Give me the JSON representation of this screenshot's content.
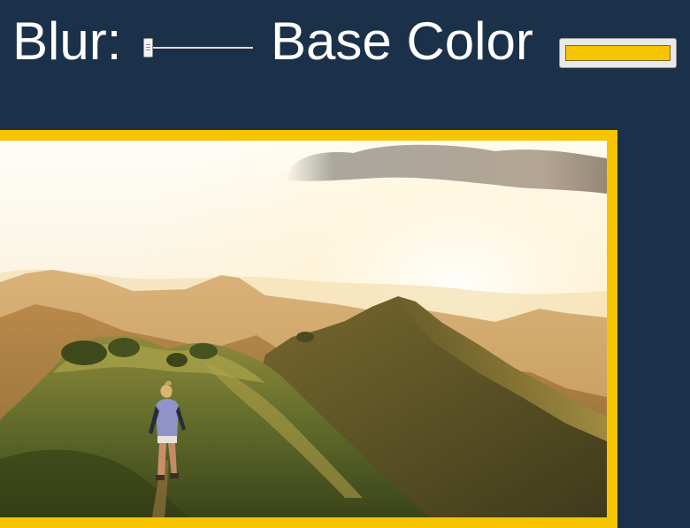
{
  "controls": {
    "blur_label": "Blur:",
    "blur_value": 0,
    "base_color_label": "Base Color",
    "base_color_value": "#f6c400"
  },
  "colors": {
    "background": "#1b3149",
    "accent": "#f6c400",
    "label_text": "#ffffff"
  },
  "photo": {
    "subject": "hiker-on-mountain-ridge-at-sunrise"
  }
}
